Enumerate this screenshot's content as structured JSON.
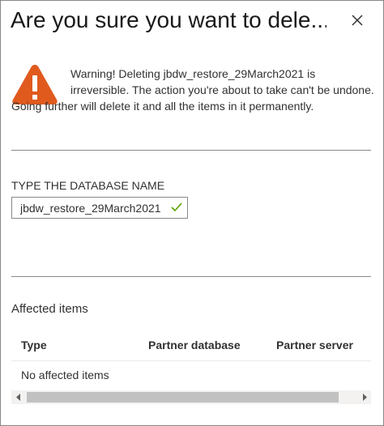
{
  "dialog": {
    "title": "Are you sure you want to dele...",
    "close_icon": "close-icon"
  },
  "warning": {
    "icon": "warning-triangle-icon",
    "icon_color": "#E05A1E",
    "message": "Warning! Deleting jbdw_restore_29March2021 is irreversible. The action you're about to take can't be undone. Going further will delete it and all the items in it permanently."
  },
  "confirm_field": {
    "label": "TYPE THE DATABASE NAME",
    "value": "jbdw_restore_29March2021",
    "valid_icon": "checkmark-icon",
    "valid_color": "#57A300"
  },
  "affected": {
    "section_title": "Affected items",
    "columns": [
      "Type",
      "Partner database",
      "Partner server"
    ],
    "empty_message": "No affected items"
  },
  "scrollbar": {
    "left_icon": "scroll-left-arrow-icon",
    "right_icon": "scroll-right-arrow-icon"
  }
}
